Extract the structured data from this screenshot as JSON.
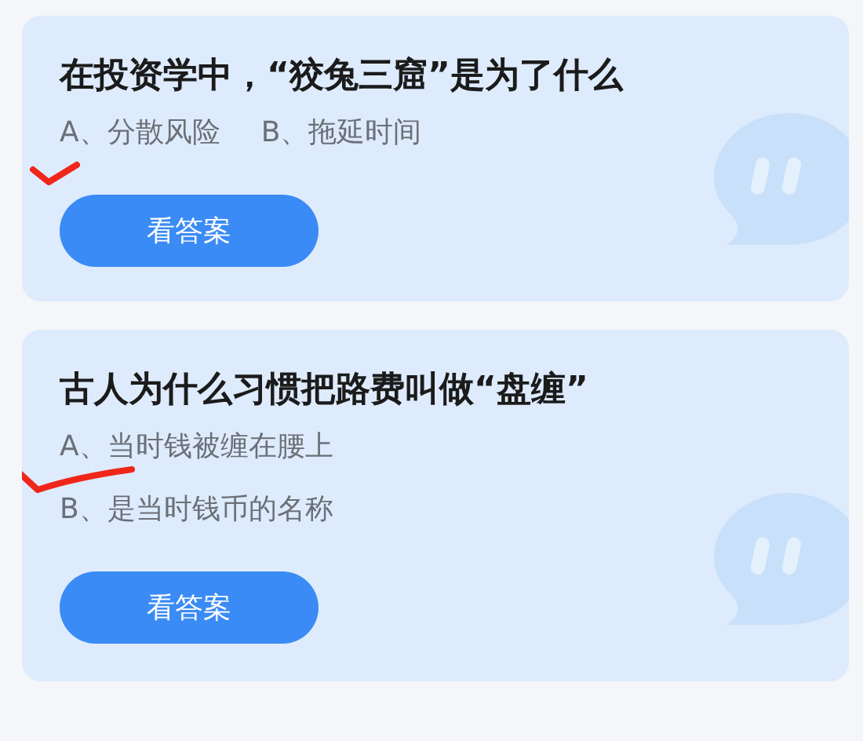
{
  "cards": [
    {
      "question": "在投资学中，“狡兔三窟”是为了什么",
      "kind": "inline",
      "options": [
        {
          "text": "A、分散风险",
          "marked": true
        },
        {
          "text": "B、拖延时间",
          "marked": false
        }
      ],
      "button": "看答案"
    },
    {
      "question": "古人为什么习惯把路费叫做“盘缠”",
      "kind": "stacked",
      "options": [
        {
          "text": "A、当时钱被缠在腰上",
          "marked": true
        },
        {
          "text": "B、是当时钱币的名称",
          "marked": false
        }
      ],
      "button": "看答案"
    }
  ]
}
